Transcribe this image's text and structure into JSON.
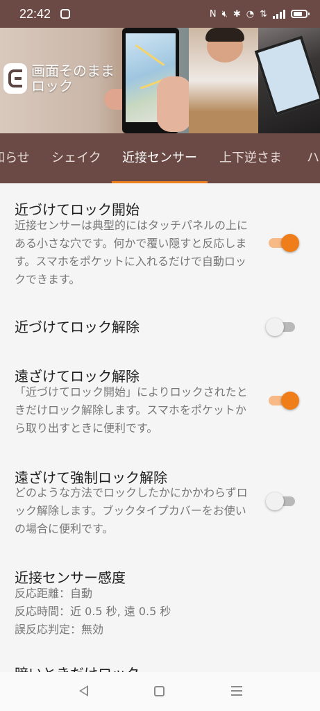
{
  "status_bar": {
    "time": "22:42",
    "icons": [
      "app-notification-icon",
      "nfc-icon",
      "mute-icon",
      "bluetooth-icon",
      "wifi-icon",
      "data-icon",
      "signal-icon",
      "battery-icon"
    ]
  },
  "banner": {
    "app_name_line1": "画面そのまま",
    "app_name_line2": "ロック"
  },
  "tabs": [
    {
      "label": "知らせ"
    },
    {
      "label": "シェイク"
    },
    {
      "label": "近接センサー"
    },
    {
      "label": "上下逆さま"
    },
    {
      "label": "ハー"
    }
  ],
  "active_tab_index": 2,
  "settings": [
    {
      "title": "近づけてロック開始",
      "description": "近接センサーは典型的にはタッチパネルの上にある小さな穴です。何かで覆い隠すと反応します。スマホをポケットに入れるだけで自動ロックできます。",
      "enabled": true
    },
    {
      "title": "近づけてロック解除",
      "description": "",
      "enabled": false
    },
    {
      "title": "遠ざけてロック解除",
      "description": "「近づけてロック開始」によりロックされたときだけロック解除します。スマホをポケットから取り出すときに便利です。",
      "enabled": true
    },
    {
      "title": "遠ざけて強制ロック解除",
      "description": "どのような方法でロックしたかにかかわらずロック解除します。ブックタイプカバーをお使いの場合に便利です。",
      "enabled": false
    }
  ],
  "sensitivity": {
    "title": "近接センサー感度",
    "lines": [
      "反応距離：自動",
      "反応時間：近 0.5 秒, 遠 0.5 秒",
      "誤反応判定：無効"
    ]
  },
  "partial_next_title": "暗いときだけロック",
  "colors": {
    "primary_brown": "#6b4a45",
    "accent_orange": "#ef7d1a"
  }
}
